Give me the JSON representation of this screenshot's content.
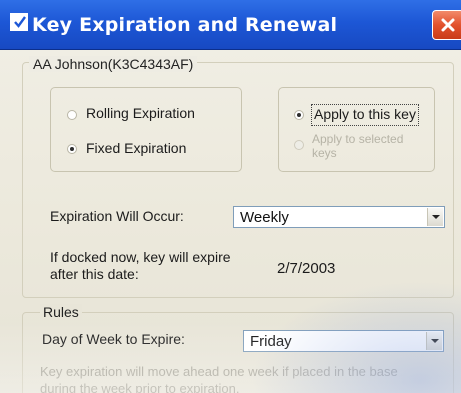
{
  "window": {
    "title": "Key Expiration and Renewal",
    "title_icon": "checkbox-icon",
    "close_icon": "close-icon"
  },
  "key_group": {
    "label": "AA Johnson(K3C4343AF)"
  },
  "expiration_type": {
    "rolling": {
      "label": "Rolling Expiration",
      "checked": false
    },
    "fixed": {
      "label": "Fixed Expiration",
      "checked": true
    }
  },
  "apply_scope": {
    "this_key": {
      "label": "Apply to this key",
      "checked": true
    },
    "selected_keys": {
      "label": "Apply to selected keys",
      "checked": false,
      "disabled": true
    }
  },
  "expiration_occur": {
    "label": "Expiration Will Occur:",
    "value": "Weekly"
  },
  "docked_expire": {
    "label": "If docked now, key will expire after this date:",
    "value": "2/7/2003"
  },
  "rules": {
    "label": "Rules",
    "day_label": "Day of Week to Expire:",
    "day_value": "Friday",
    "note": "Key expiration will move ahead one week if placed in the base during the week prior to expiration."
  },
  "colors": {
    "titlebar": "#1d57d6",
    "close": "#e2522e",
    "combo_border": "#7f9db9"
  }
}
